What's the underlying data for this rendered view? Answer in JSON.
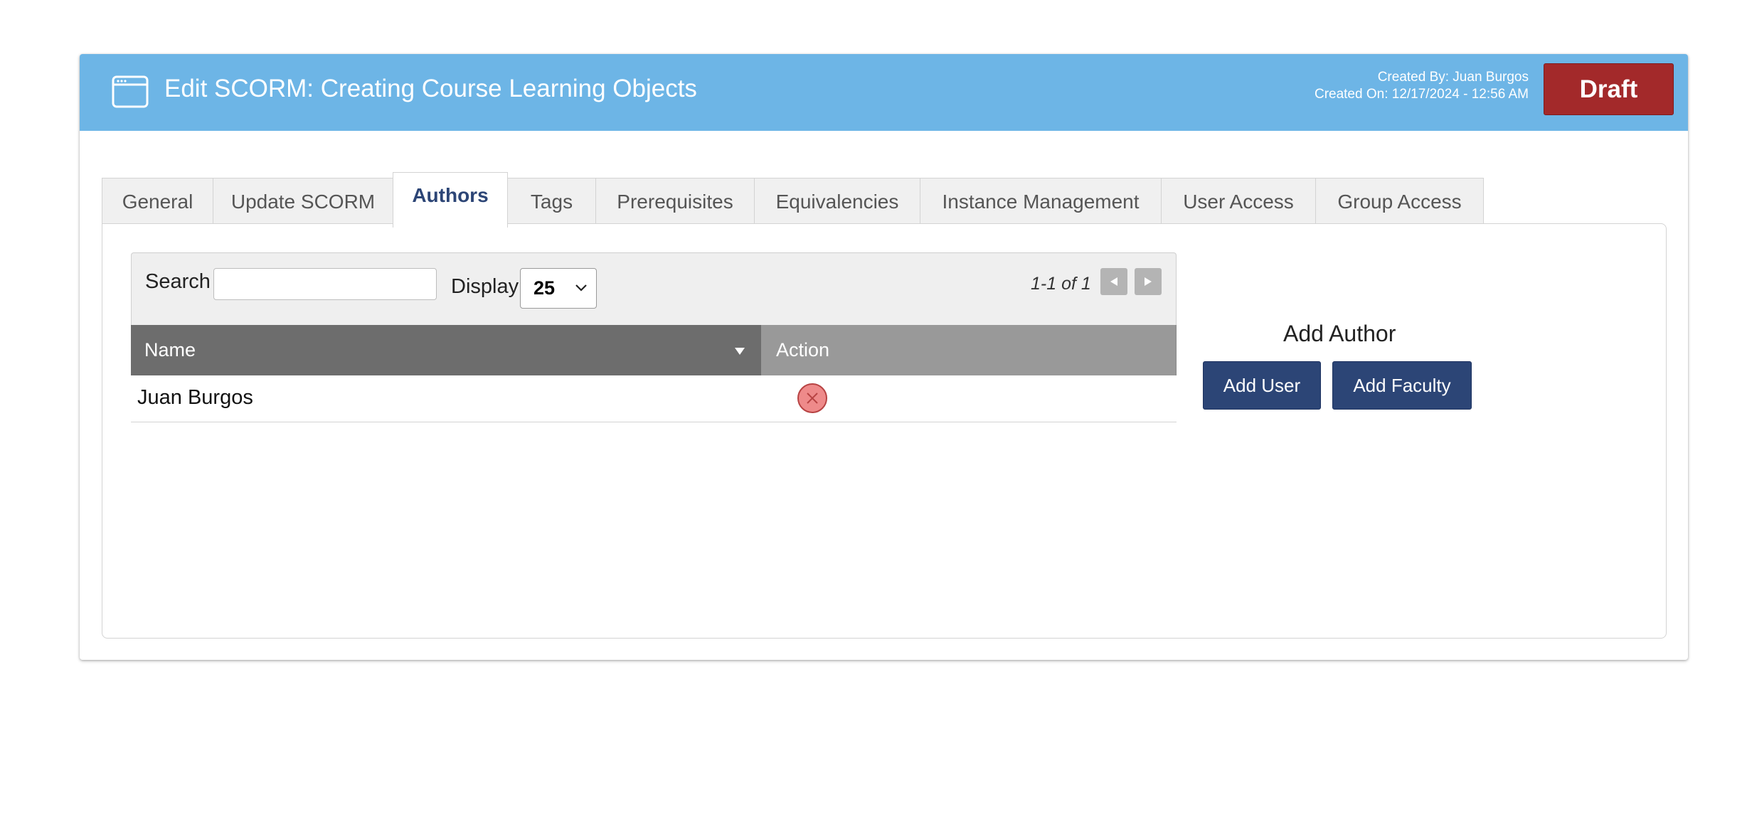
{
  "header": {
    "title": "Edit SCORM: Creating Course Learning Objects",
    "created_by": "Created By: Juan Burgos",
    "created_on": "Created On: 12/17/2024 - 12:56 AM",
    "status_label": "Draft",
    "icon": "browser-window-icon"
  },
  "tabs": [
    {
      "label": "General",
      "active": false
    },
    {
      "label": "Update SCORM",
      "active": false
    },
    {
      "label": "Authors",
      "active": true
    },
    {
      "label": "Tags",
      "active": false
    },
    {
      "label": "Prerequisites",
      "active": false
    },
    {
      "label": "Equivalencies",
      "active": false
    },
    {
      "label": "Instance Management",
      "active": false
    },
    {
      "label": "User Access",
      "active": false
    },
    {
      "label": "Group Access",
      "active": false
    }
  ],
  "grid": {
    "search_label": "Search",
    "search_value": "",
    "display_label": "Display",
    "display_value": "25",
    "page_info": "1-1 of 1",
    "columns": {
      "name": "Name",
      "action": "Action"
    },
    "rows": [
      {
        "name": "Juan Burgos"
      }
    ]
  },
  "add_author": {
    "title": "Add Author",
    "add_user_label": "Add User",
    "add_faculty_label": "Add Faculty"
  },
  "colors": {
    "header_bg": "#6db5e6",
    "draft": "#a3292a",
    "primary": "#2c4576"
  }
}
